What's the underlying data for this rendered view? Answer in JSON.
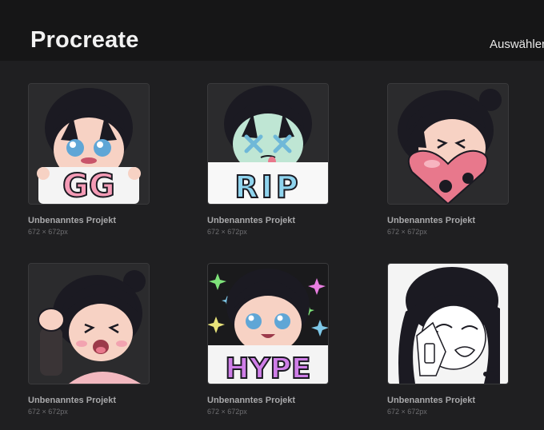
{
  "header": {
    "title": "Procreate",
    "select_label": "Auswählen"
  },
  "gallery": {
    "artworks": [
      {
        "name": "Unbenanntes Projekt",
        "size": "672 × 672px",
        "sign_text": "GG",
        "background": "#2b2b2d"
      },
      {
        "name": "Unbenanntes Projekt",
        "size": "672 × 672px",
        "sign_text": "RIP",
        "background": "#2b2b2d"
      },
      {
        "name": "Unbenanntes Projekt",
        "size": "672 × 672px",
        "sign_text": "",
        "background": "#2b2b2d"
      },
      {
        "name": "Unbenanntes Projekt",
        "size": "672 × 672px",
        "sign_text": "",
        "background": "#2b2b2d"
      },
      {
        "name": "Unbenanntes Projekt",
        "size": "672 × 672px",
        "sign_text": "HYPE",
        "background": "#1a1a1c"
      },
      {
        "name": "Unbenanntes Projekt",
        "size": "672 × 672px",
        "sign_text": "",
        "background": "#f4f4f4"
      }
    ]
  },
  "colors": {
    "hair": "#1b1a22",
    "skin": "#f7d2c4",
    "gg_pink": "#f59bb6",
    "rip_blue": "#8fd4ee",
    "hype_purple": "#cf7ee8",
    "heart_pink": "#e8788c"
  }
}
